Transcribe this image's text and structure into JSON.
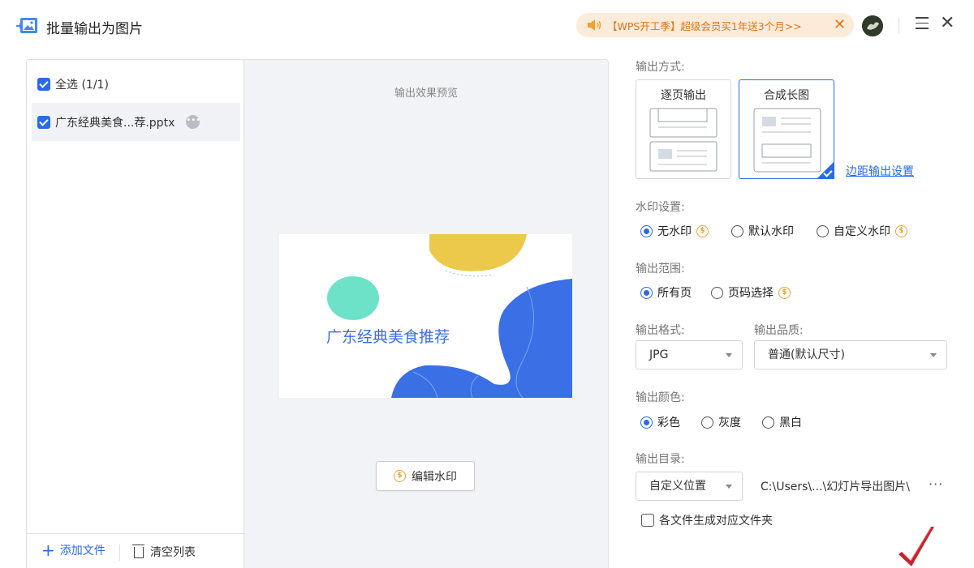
{
  "titlebar": {
    "title": "批量输出为图片",
    "promo_text": "【WPS开工季】超级会员买1年送3个月>>",
    "promo_close": "✕",
    "close": "✕"
  },
  "file_panel": {
    "select_all_label": "全选 (1/1)",
    "files": [
      {
        "name": "广东经典美食...荐.pptx",
        "checked": true
      }
    ],
    "add_file_label": "添加文件",
    "clear_list_label": "清空列表"
  },
  "preview": {
    "title": "输出效果预览",
    "slide_title": "广东经典美食推荐",
    "edit_watermark_label": "编辑水印"
  },
  "settings": {
    "output_mode": {
      "label": "输出方式:",
      "options": [
        "逐页输出",
        "合成长图"
      ],
      "selected": "合成长图",
      "margin_link": "边距输出设置"
    },
    "watermark": {
      "label": "水印设置:",
      "options": [
        "无水印",
        "默认水印",
        "自定义水印"
      ],
      "selected": "无水印"
    },
    "range": {
      "label": "输出范围:",
      "options": [
        "所有页",
        "页码选择"
      ],
      "selected": "所有页"
    },
    "format": {
      "label": "输出格式:",
      "value": "JPG"
    },
    "quality": {
      "label": "输出品质:",
      "value": "普通(默认尺寸)"
    },
    "color": {
      "label": "输出颜色:",
      "options": [
        "彩色",
        "灰度",
        "黑白"
      ],
      "selected": "彩色"
    },
    "directory": {
      "label": "输出目录:",
      "location": "自定义位置",
      "path": "C:\\Users\\...\\幻灯片导出图片\\",
      "more": "···"
    },
    "per_file_folder": {
      "label": "各文件生成对应文件夹",
      "checked": false
    }
  },
  "icons": {
    "app": "image-export-icon",
    "promo": "speaker-icon",
    "coin": "coin-icon",
    "add": "plus-icon",
    "clear": "trash-icon"
  },
  "colors": {
    "accent": "#2a6ae8",
    "promo_bg": "#fdebd9",
    "promo_text": "#e0741a",
    "coin": "#f0a22e",
    "slide_yellow": "#ecc94b",
    "slide_mint": "#6ee2c9",
    "slide_blue": "#3a6fe6"
  }
}
